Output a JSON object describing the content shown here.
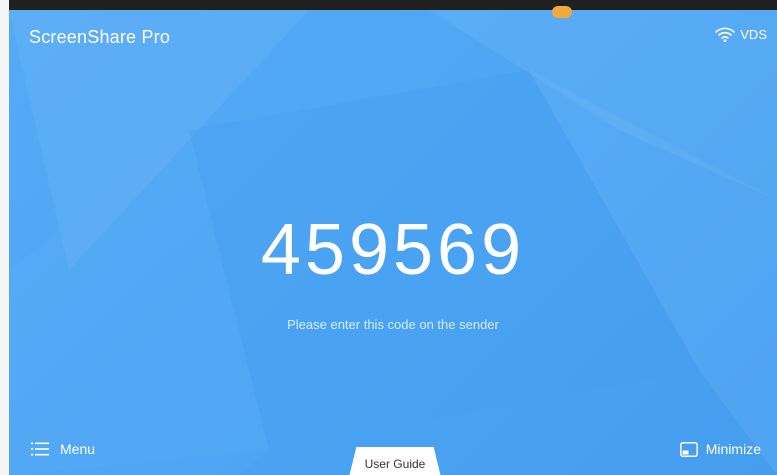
{
  "app": {
    "title": "ScreenShare Pro"
  },
  "status": {
    "network_name": "VDS",
    "icon": "wifi-icon"
  },
  "pairing": {
    "code": "459569",
    "hint": "Please enter this code on the sender"
  },
  "footer": {
    "menu_label": "Menu",
    "user_guide_label": "User Guide",
    "minimize_label": "Minimize"
  },
  "colors": {
    "background": "#4ea6f4",
    "text": "#ffffff",
    "accent_nub": "#f3a93a"
  }
}
